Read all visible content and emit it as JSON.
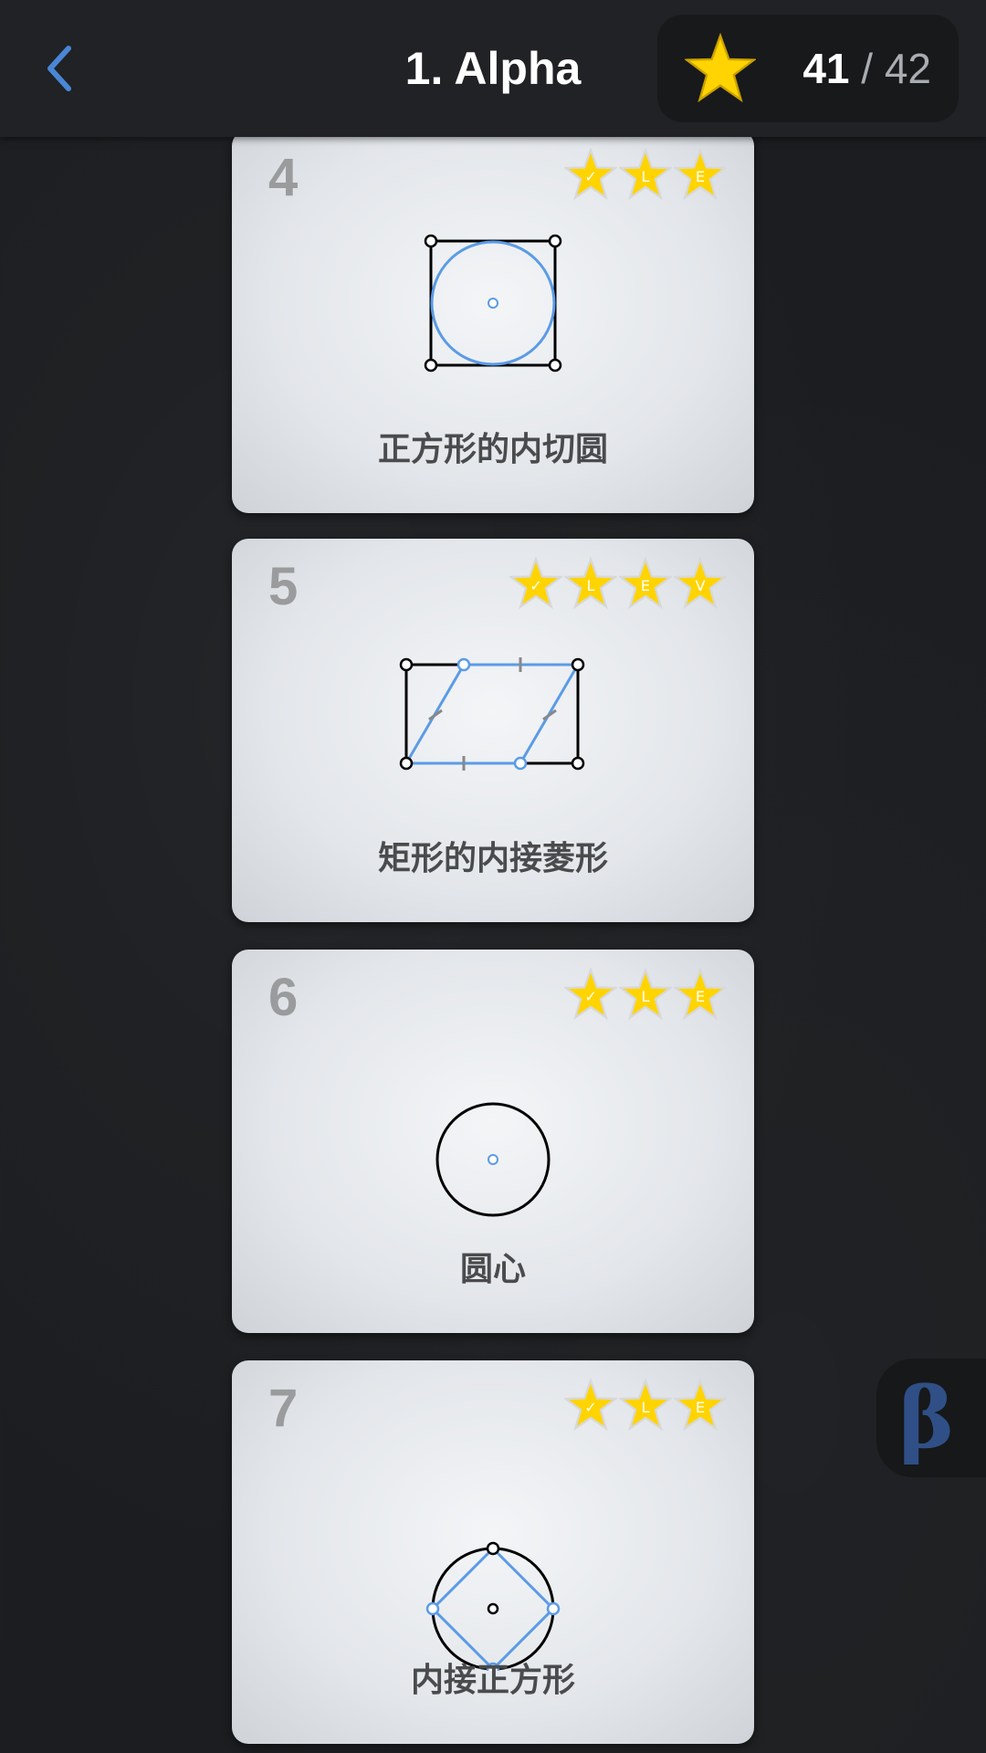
{
  "header": {
    "title": "1. Alpha",
    "score_current": "41",
    "score_separator": "/",
    "score_total": "42"
  },
  "colors": {
    "accent_blue": "#5b9be6",
    "star_yellow": "#ffd400",
    "card_text": "#4a4b4d",
    "beta": "#2f4f86"
  },
  "levels": [
    {
      "number": "4",
      "title": "正方形的内切圆",
      "stars": [
        "✓",
        "L",
        "E"
      ]
    },
    {
      "number": "5",
      "title": "矩形的内接菱形",
      "stars": [
        "✓",
        "L",
        "E",
        "V"
      ]
    },
    {
      "number": "6",
      "title": "圆心",
      "stars": [
        "✓",
        "L",
        "E"
      ]
    },
    {
      "number": "7",
      "title": "内接正方形",
      "stars": [
        "✓",
        "L",
        "E"
      ]
    }
  ],
  "beta_button": {
    "label": "β"
  }
}
